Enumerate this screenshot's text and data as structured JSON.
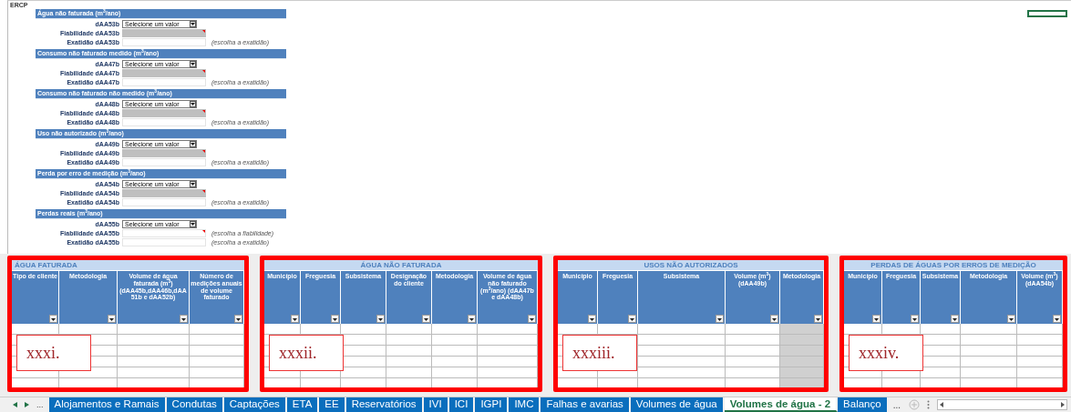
{
  "sheet_label": "ERCP",
  "sections": [
    {
      "title": "Água não faturada (m$^{3}$/ano)",
      "fields": [
        {
          "kind": "select",
          "label": "dAA53b",
          "value": "Selecione um valor"
        },
        {
          "kind": "input",
          "label": "Fiabilidade dAA53b",
          "shaded": true,
          "comment": true
        },
        {
          "kind": "input",
          "label": "Exatidão dAA53b",
          "shaded": false,
          "comment": false,
          "hint": "(escolha a exatidão)"
        }
      ]
    },
    {
      "title": "Consumo não faturado medido (m$^{3}$/ano)",
      "fields": [
        {
          "kind": "select",
          "label": "dAA47b",
          "value": "Selecione um valor"
        },
        {
          "kind": "input",
          "label": "Fiabilidade dAA47b",
          "shaded": true,
          "comment": true
        },
        {
          "kind": "input",
          "label": "Exatidão dAA47b",
          "shaded": false,
          "comment": false,
          "hint": "(escolha a exatidão)"
        }
      ]
    },
    {
      "title": "Consumo não faturado não medido (m$^{3}$/ano)",
      "fields": [
        {
          "kind": "select",
          "label": "dAA48b",
          "value": "Selecione um valor"
        },
        {
          "kind": "input",
          "label": "Fiabilidade dAA48b",
          "shaded": true,
          "comment": true
        },
        {
          "kind": "input",
          "label": "Exatidão dAA48b",
          "shaded": false,
          "comment": false,
          "hint": "(escolha a exatidão)"
        }
      ]
    },
    {
      "title": "Uso não autorizado (m$^{3}$/ano)",
      "fields": [
        {
          "kind": "select",
          "label": "dAA49b",
          "value": "Selecione um valor"
        },
        {
          "kind": "input",
          "label": "Fiabilidade dAA49b",
          "shaded": true,
          "comment": true
        },
        {
          "kind": "input",
          "label": "Exatidão dAA49b",
          "shaded": false,
          "comment": false,
          "hint": "(escolha a exatidão)"
        }
      ]
    },
    {
      "title": "Perda por erro de medição (m$^{3}$/ano)",
      "fields": [
        {
          "kind": "select",
          "label": "dAA54b",
          "value": "Selecione um valor"
        },
        {
          "kind": "input",
          "label": "Fiabilidade dAA54b",
          "shaded": true,
          "comment": true
        },
        {
          "kind": "input",
          "label": "Exatidão dAA54b",
          "shaded": false,
          "comment": false,
          "hint": "(escolha a exatidão)"
        }
      ]
    },
    {
      "title": "Perdas reais (m$^{3}$/ano)",
      "fields": [
        {
          "kind": "select",
          "label": "dAA55b",
          "value": "Selecione um valor"
        },
        {
          "kind": "input",
          "label": "Fiabilidade dAA55b",
          "shaded": false,
          "comment": true,
          "hint": "(escolha a fiabilidade)"
        },
        {
          "kind": "input",
          "label": "Exatidão dAA55b",
          "shaded": false,
          "comment": false,
          "hint": "(escolha a exatidão)"
        }
      ]
    }
  ],
  "tables": [
    {
      "title": "ÁGUA FATURADA",
      "annotation": "xxxi.",
      "columns": [
        {
          "label": "Tipo de cliente",
          "shaded": false
        },
        {
          "label": "Metodologia",
          "shaded": false
        },
        {
          "label": "Volume de água faturada (m$^{3}$) (dAA45b,dAA46b,dAA51b e dAA52b)",
          "shaded": false
        },
        {
          "label": "Número de medições anuais de volume faturado",
          "shaded": false
        }
      ]
    },
    {
      "title": "ÁGUA NÃO FATURADA",
      "annotation": "xxxii.",
      "columns": [
        {
          "label": "Município",
          "shaded": false
        },
        {
          "label": "Freguesia",
          "shaded": false
        },
        {
          "label": "Subsistema",
          "shaded": false
        },
        {
          "label": "Designação do cliente",
          "shaded": false
        },
        {
          "label": "Metodologia",
          "shaded": false
        },
        {
          "label": "Volume de água não faturado (m$^{3}$/ano) (dAA47b e dAA48b)",
          "shaded": false
        }
      ]
    },
    {
      "title": "USOS NÃO AUTORIZADOS",
      "annotation": "xxxiii.",
      "columns": [
        {
          "label": "Município",
          "shaded": false
        },
        {
          "label": "Freguesia",
          "shaded": false
        },
        {
          "label": "Subsistema",
          "shaded": false
        },
        {
          "label": "Volume (m$^{3}$) (dAA49b)",
          "shaded": false
        },
        {
          "label": "Metodologia",
          "shaded": true
        }
      ]
    },
    {
      "title": "PERDAS DE ÁGUAS POR ERROS DE MEDIÇÃO",
      "annotation": "xxxiv.",
      "columns": [
        {
          "label": "Município",
          "shaded": false
        },
        {
          "label": "Freguesia",
          "shaded": false
        },
        {
          "label": "Subsistema",
          "shaded": false
        },
        {
          "label": "Metodologia",
          "shaded": false
        },
        {
          "label": "Volume (m$^{3}$) (dAA54b)",
          "shaded": false
        }
      ]
    }
  ],
  "tab_bar": {
    "more_left": "...",
    "more_right": "...",
    "tabs": [
      {
        "label": "Alojamentos e Ramais",
        "selected": false
      },
      {
        "label": "Condutas",
        "selected": false
      },
      {
        "label": "Captações",
        "selected": false
      },
      {
        "label": "ETA",
        "selected": false
      },
      {
        "label": "EE",
        "selected": false
      },
      {
        "label": "Reservatórios",
        "selected": false
      },
      {
        "label": "IVI",
        "selected": false
      },
      {
        "label": "ICI",
        "selected": false
      },
      {
        "label": "IGPI",
        "selected": false
      },
      {
        "label": "IMC",
        "selected": false
      },
      {
        "label": "Falhas e avarias",
        "selected": false
      },
      {
        "label": "Volumes de água",
        "selected": false
      },
      {
        "label": "Volumes de água - 2",
        "selected": true
      },
      {
        "label": "Balanço",
        "selected": false
      }
    ]
  }
}
